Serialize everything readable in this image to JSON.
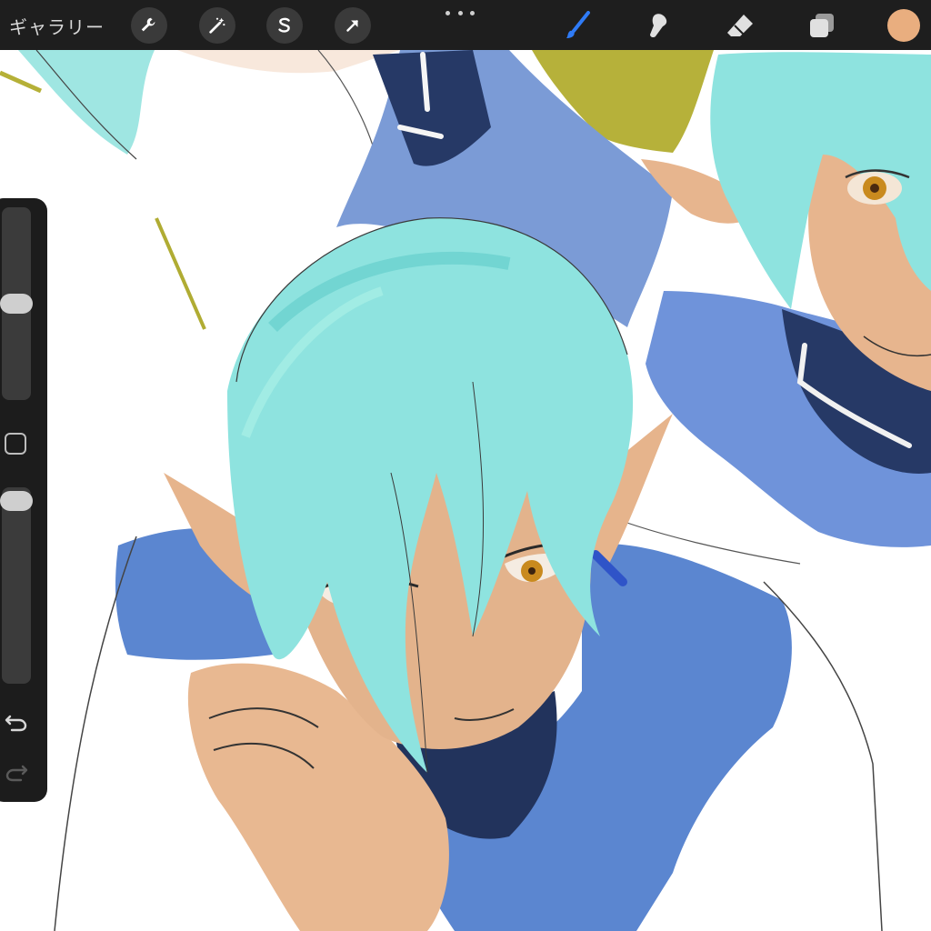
{
  "toolbar": {
    "gallery_label": "ギャラリー",
    "left_tools": [
      {
        "name": "actions",
        "icon": "wrench-icon"
      },
      {
        "name": "adjustments",
        "icon": "magic-wand-icon"
      },
      {
        "name": "selection",
        "icon": "selection-s-icon"
      },
      {
        "name": "transform",
        "icon": "arrow-cursor-icon"
      }
    ],
    "more_icon": "more-dots-icon",
    "right_tools": [
      {
        "name": "brush",
        "icon": "brush-icon",
        "active": true
      },
      {
        "name": "smudge",
        "icon": "smudge-icon"
      },
      {
        "name": "eraser",
        "icon": "eraser-icon"
      },
      {
        "name": "layers",
        "icon": "layers-icon"
      }
    ],
    "current_color": "#E9AE7F",
    "active_tool_color": "#2F7BF6"
  },
  "sidebar": {
    "brush_size_level": 0.5,
    "opacity_level": 0.0,
    "icons": [
      "modify-square-icon",
      "undo-icon",
      "redo-icon"
    ]
  },
  "colors": {
    "toolbar_bg": "#1E1E1E",
    "hair": "#8EE3E0",
    "skin": "#E6B48C",
    "coat_blue": "#5B86D0",
    "coat_dark": "#23345E",
    "olive": "#B5B037",
    "eye": "#C98A1E"
  }
}
